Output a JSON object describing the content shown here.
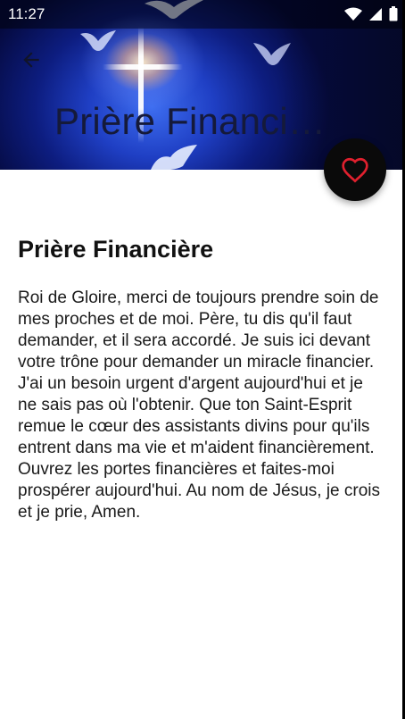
{
  "status_bar": {
    "time": "11:27",
    "icons": [
      "wifi-icon",
      "signal-icon",
      "battery-icon"
    ]
  },
  "header": {
    "back_icon": "arrow-left-icon",
    "title": "Prière Financiè..."
  },
  "favorite": {
    "icon": "heart-outline-icon",
    "icon_color": "#e0202e",
    "button_color": "#0a0a0a"
  },
  "prayer": {
    "title": "Prière Financière",
    "body": "Roi de Gloire, merci de toujours prendre soin de mes proches et de moi. Père, tu dis qu'il faut demander, et il sera accordé. Je suis ici devant votre trône pour demander un miracle financier. J'ai un besoin urgent d'argent aujourd'hui et je ne sais pas où l'obtenir. Que ton Saint-Esprit remue le cœur des assistants divins pour qu'ils entrent dans ma vie et m'aident financièrement. Ouvrez les portes financières et faites-moi prospérer aujourd'hui. Au nom de Jésus, je crois et je prie, Amen."
  }
}
